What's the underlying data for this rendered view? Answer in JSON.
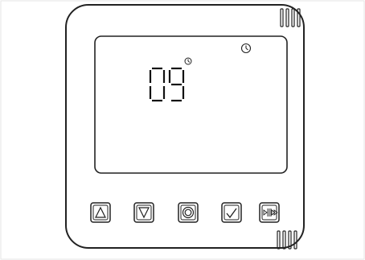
{
  "device": {
    "display": {
      "value": "09",
      "indicator_icons": [
        "clock-icon",
        "clock-icon"
      ]
    },
    "buttons": [
      {
        "id": "up",
        "icon": "up-arrow-icon"
      },
      {
        "id": "down",
        "icon": "down-arrow-icon"
      },
      {
        "id": "power",
        "icon": "power-ring-icon"
      },
      {
        "id": "confirm",
        "icon": "checkmark-icon"
      },
      {
        "id": "fan",
        "icon": "fan-speed-icon"
      }
    ]
  }
}
